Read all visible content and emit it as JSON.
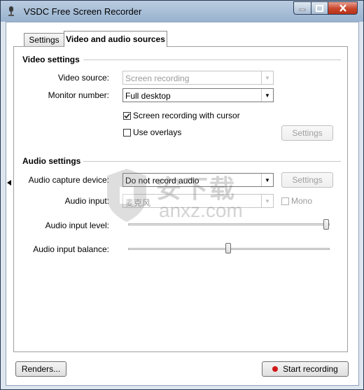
{
  "window": {
    "title": "VSDC Free Screen Recorder"
  },
  "tabs": [
    {
      "label": "Settings"
    },
    {
      "label": "Video and audio sources"
    }
  ],
  "video_settings": {
    "heading": "Video settings",
    "video_source": {
      "label": "Video source:",
      "value": "Screen recording",
      "enabled": false
    },
    "monitor_number": {
      "label": "Monitor number:",
      "value": "Full desktop",
      "enabled": true
    },
    "cursor_checkbox": {
      "label": "Screen recording with cursor",
      "checked": true
    },
    "overlays_checkbox": {
      "label": "Use overlays",
      "checked": false
    },
    "overlays_settings_button": "Settings"
  },
  "audio_settings": {
    "heading": "Audio settings",
    "capture_device": {
      "label": "Audio capture device:",
      "value": "Do not record audio"
    },
    "capture_settings_button": "Settings",
    "audio_input": {
      "label": "Audio input:",
      "value": "麦克风"
    },
    "mono_checkbox": {
      "label": "Mono",
      "checked": false
    },
    "input_level": {
      "label": "Audio input level:",
      "value": 1.0
    },
    "input_balance": {
      "label": "Audio input balance:",
      "value": 0.5
    }
  },
  "footer": {
    "renders_button": "Renders...",
    "start_button": "Start recording"
  },
  "watermark": {
    "line1": "安下载",
    "line2": "anxz.com"
  },
  "colors": {
    "record_dot": "#d01818",
    "close_button": "#c9462c",
    "titlebar": "#a9bfd8"
  }
}
